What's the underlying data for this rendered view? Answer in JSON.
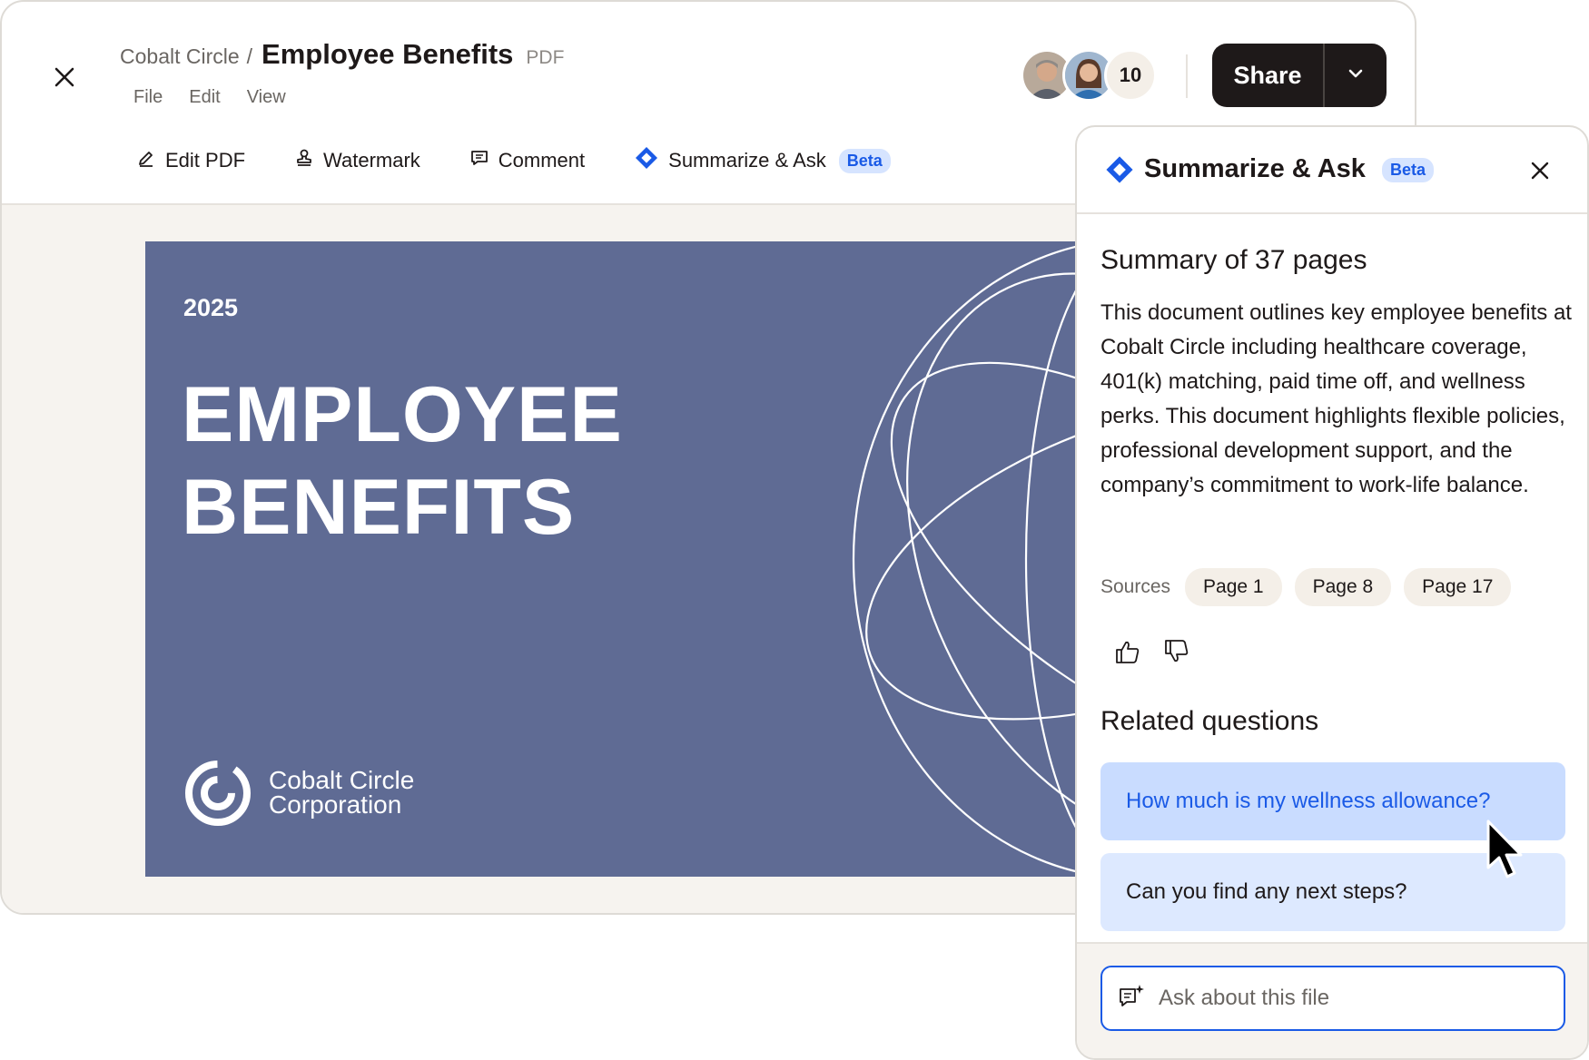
{
  "header": {
    "breadcrumb_parent": "Cobalt Circle",
    "breadcrumb_separator": "/",
    "title": "Employee Benefits",
    "file_type": "PDF",
    "menu": [
      "File",
      "Edit",
      "View"
    ],
    "collaborator_count": "10",
    "share_label": "Share"
  },
  "toolbar": {
    "edit_pdf": "Edit PDF",
    "watermark": "Watermark",
    "comment": "Comment",
    "summarize": "Summarize & Ask",
    "beta": "Beta"
  },
  "document": {
    "year": "2025",
    "title_line1": "EMPLOYEE",
    "title_line2": "BENEFITS",
    "company_line1": "Cobalt Circle",
    "company_line2": "Corporation"
  },
  "panel": {
    "title": "Summarize & Ask",
    "beta": "Beta",
    "summary_heading": "Summary of 37 pages",
    "summary_text": "This document outlines key employee benefits at Cobalt Circle including healthcare coverage, 401(k) matching, paid time off, and wellness perks. This document highlights flexible policies, professional development support, and the company’s commitment to work-life balance.",
    "sources_label": "Sources",
    "sources": [
      "Page 1",
      "Page 8",
      "Page 17"
    ],
    "related_heading": "Related questions",
    "questions": [
      "How much is my wellness allowance?",
      "Can you find any next steps?"
    ],
    "ask_placeholder": "Ask about this file"
  },
  "colors": {
    "accent": "#1a5ae6",
    "dark": "#1e1919",
    "cover": "#5f6b94",
    "beige": "#f6f3ef"
  },
  "icons": [
    "close-icon",
    "pencil-icon",
    "stamp-icon",
    "comment-icon",
    "diamond-logo-icon",
    "chevron-down-icon",
    "thumbs-up-icon",
    "thumbs-down-icon",
    "chat-sparkle-icon",
    "cursor-icon"
  ]
}
